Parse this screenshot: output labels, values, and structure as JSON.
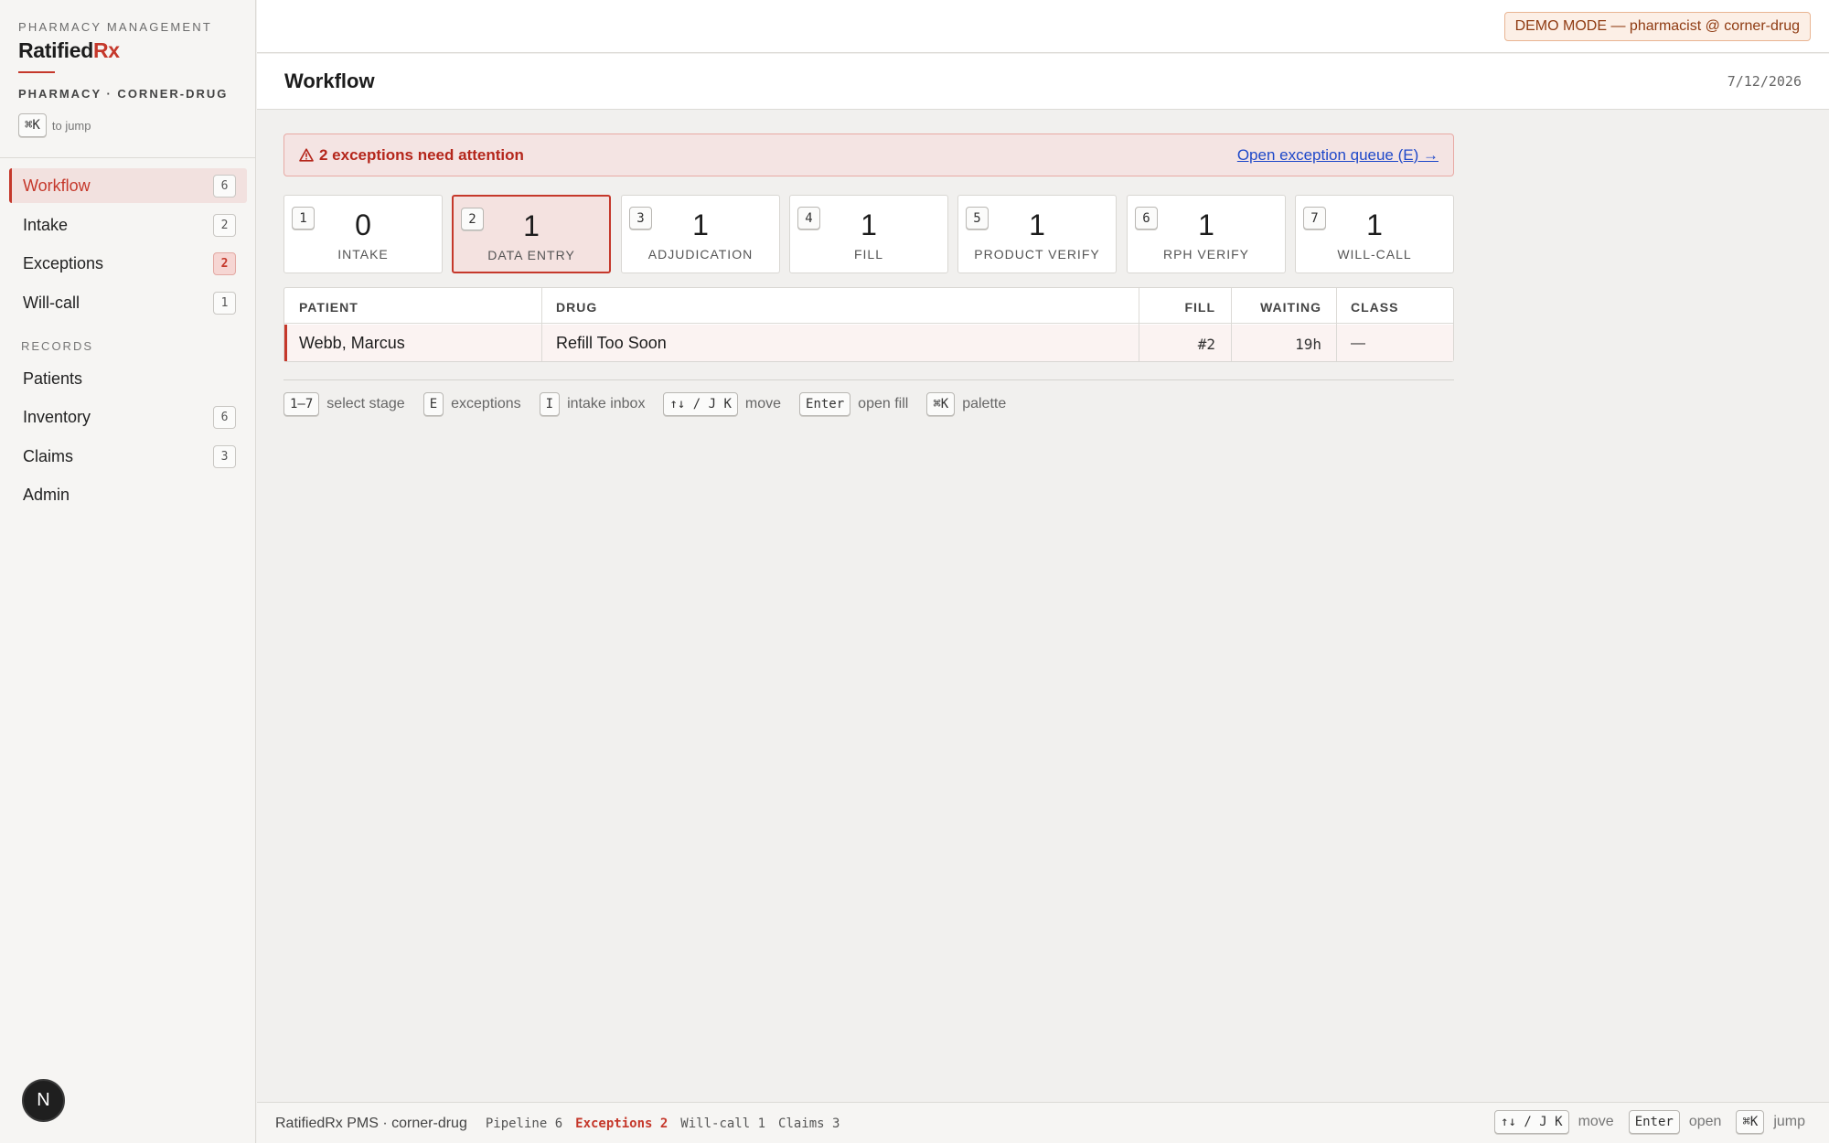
{
  "brand": {
    "eyebrow": "PHARMACY MANAGEMENT",
    "name_main": "Ratified",
    "name_accent": "Rx",
    "pharmacy": "PHARMACY · CORNER-DRUG",
    "jump_key": "⌘K",
    "jump_text": "to jump"
  },
  "nav": {
    "items": [
      {
        "label": "Workflow",
        "count": "6"
      },
      {
        "label": "Intake",
        "count": "2"
      },
      {
        "label": "Exceptions",
        "count": "2"
      },
      {
        "label": "Will-call",
        "count": "1"
      }
    ],
    "records_label": "RECORDS",
    "records": [
      {
        "label": "Patients",
        "count": ""
      },
      {
        "label": "Inventory",
        "count": "6"
      },
      {
        "label": "Claims",
        "count": "3"
      },
      {
        "label": "Admin",
        "count": ""
      }
    ]
  },
  "user": {
    "avatar_letter": "N"
  },
  "topbar": {
    "demo_badge": "DEMO MODE — pharmacist @ corner-drug"
  },
  "header": {
    "title": "Workflow",
    "date": "7/12/2026"
  },
  "alert": {
    "icon": "warning-icon",
    "message": "2 exceptions need attention",
    "link": "Open exception queue (E) →"
  },
  "stages": [
    {
      "key": "1",
      "count": "0",
      "label": "INTAKE"
    },
    {
      "key": "2",
      "count": "1",
      "label": "DATA ENTRY"
    },
    {
      "key": "3",
      "count": "1",
      "label": "ADJUDICATION"
    },
    {
      "key": "4",
      "count": "1",
      "label": "FILL"
    },
    {
      "key": "5",
      "count": "1",
      "label": "PRODUCT VERIFY"
    },
    {
      "key": "6",
      "count": "1",
      "label": "RPH VERIFY"
    },
    {
      "key": "7",
      "count": "1",
      "label": "WILL-CALL"
    }
  ],
  "table": {
    "columns": [
      "PATIENT",
      "DRUG",
      "FILL",
      "WAITING",
      "CLASS"
    ],
    "rows": [
      {
        "patient": "Webb, Marcus",
        "drug": "Refill Too Soon",
        "fill": "#2",
        "waiting": "19h",
        "class": "—"
      }
    ]
  },
  "hints": [
    {
      "key": "1–7",
      "text": "select stage"
    },
    {
      "key": "E",
      "text": "exceptions"
    },
    {
      "key": "I",
      "text": "intake inbox"
    },
    {
      "key": "↑↓ / J K",
      "text": "move"
    },
    {
      "key": "Enter",
      "text": "open fill"
    },
    {
      "key": "⌘K",
      "text": "palette"
    }
  ],
  "statusbar": {
    "app": "RatifiedRx PMS · corner-drug",
    "pipeline": "Pipeline 6",
    "exceptions": "Exceptions 2",
    "willcall": "Will-call 1",
    "claims": "Claims 3",
    "hints": [
      {
        "key": "↑↓ / J K",
        "text": "move"
      },
      {
        "key": "Enter",
        "text": "open"
      },
      {
        "key": "⌘K",
        "text": "jump"
      }
    ]
  },
  "colors": {
    "accent": "#c5382b",
    "link": "#1e48c9",
    "demo": "#8f3b12"
  }
}
